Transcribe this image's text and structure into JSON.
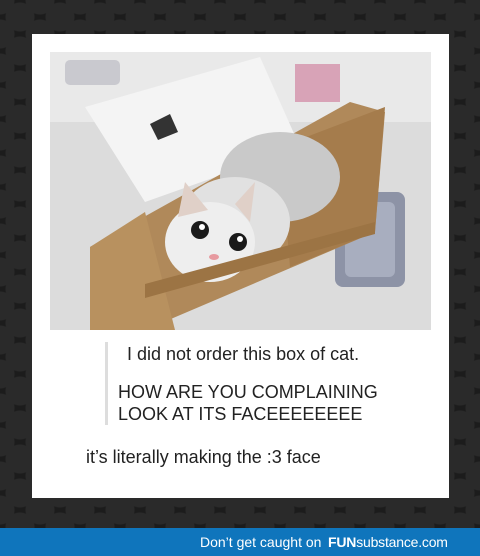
{
  "post": {
    "line1": "I did not order this box of cat.",
    "line2": "HOW ARE YOU COMPLAINING",
    "line3": "LOOK AT ITS FACEEEEEEEE",
    "line4": "it’s literally making the :3 face"
  },
  "footer": {
    "slogan": "Don’t get caught on",
    "brand_bold": "FUN",
    "brand_regular": "substance",
    "brand_suffix": ".com"
  },
  "colors": {
    "background": "#1c1c1c",
    "card": "#ffffff",
    "footer_bar": "#0f75bc",
    "text": "#222222"
  }
}
